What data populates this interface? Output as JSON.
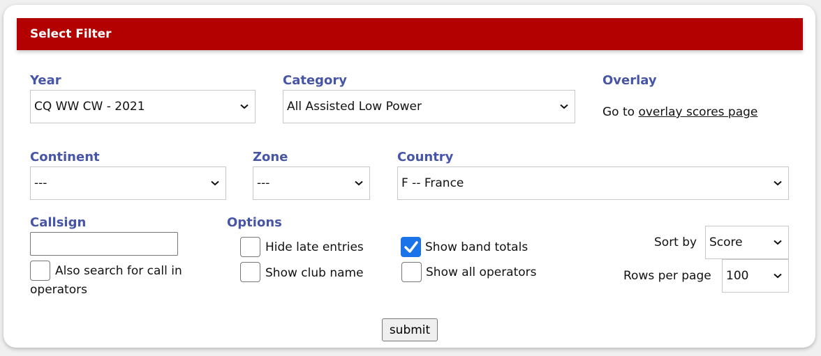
{
  "header": {
    "title": "Select Filter"
  },
  "colors": {
    "header_bg": "#b30000",
    "label": "#4655a6",
    "checkbox_checked": "#1a73e8"
  },
  "year": {
    "label": "Year",
    "selected": "CQ WW CW - 2021"
  },
  "category": {
    "label": "Category",
    "selected": "All Assisted Low Power"
  },
  "overlay": {
    "label": "Overlay",
    "prefix": "Go to",
    "link_text": "overlay scores page"
  },
  "continent": {
    "label": "Continent",
    "selected": "---"
  },
  "zone": {
    "label": "Zone",
    "selected": "---"
  },
  "country": {
    "label": "Country",
    "selected": "F -- France"
  },
  "callsign": {
    "label": "Callsign",
    "value": "",
    "placeholder": "",
    "also_search": {
      "label_line1": "Also search for call in",
      "label_line2": "operators",
      "checked": false
    }
  },
  "options": {
    "label": "Options",
    "items": [
      {
        "label": "Hide late entries",
        "checked": false
      },
      {
        "label": "Show club name",
        "checked": false
      },
      {
        "label": "Show band totals",
        "checked": true
      },
      {
        "label": "Show all operators",
        "checked": false
      }
    ]
  },
  "sort_by": {
    "label": "Sort by",
    "selected": "Score"
  },
  "rows_per_page": {
    "label": "Rows per page",
    "selected": "100"
  },
  "submit": {
    "label": "submit"
  },
  "icons": {
    "dropdown": "chevron-down-icon",
    "check": "checkmark-icon"
  }
}
